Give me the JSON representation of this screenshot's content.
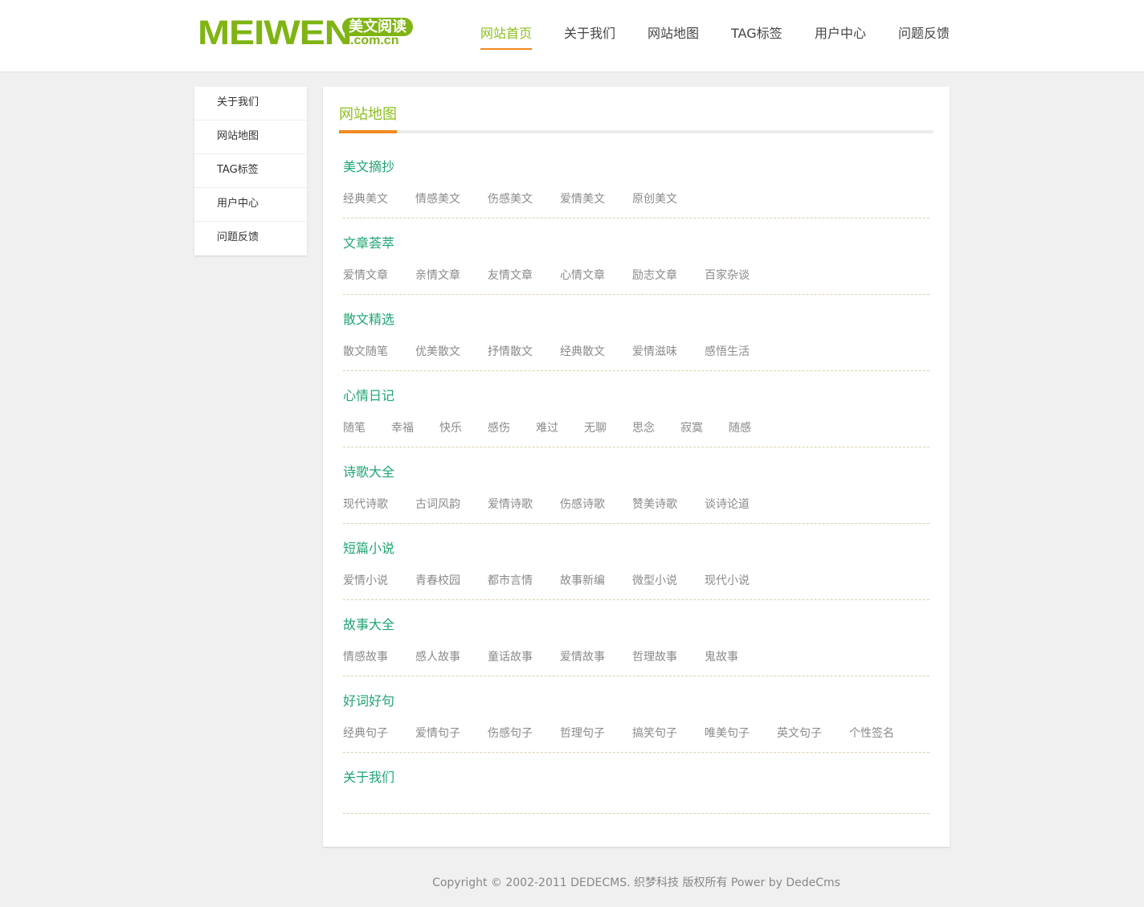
{
  "logo": {
    "main": "MEIWEN",
    "badge": "美文阅读",
    "domain": ".com.cn"
  },
  "nav": [
    {
      "label": "网站首页",
      "active": true
    },
    {
      "label": "关于我们"
    },
    {
      "label": "网站地图"
    },
    {
      "label": "TAG标签"
    },
    {
      "label": "用户中心"
    },
    {
      "label": "问题反馈"
    }
  ],
  "sidebar": [
    {
      "label": "关于我们"
    },
    {
      "label": "网站地图"
    },
    {
      "label": "TAG标签"
    },
    {
      "label": "用户中心"
    },
    {
      "label": "问题反馈"
    }
  ],
  "main": {
    "title": "网站地图",
    "sections": [
      {
        "title": "美文摘抄",
        "links": [
          "经典美文",
          "情感美文",
          "伤感美文",
          "爱情美文",
          "原创美文"
        ]
      },
      {
        "title": "文章荟萃",
        "links": [
          "爱情文章",
          "亲情文章",
          "友情文章",
          "心情文章",
          "励志文章",
          "百家杂谈"
        ]
      },
      {
        "title": "散文精选",
        "links": [
          "散文随笔",
          "优美散文",
          "抒情散文",
          "经典散文",
          "爱情滋味",
          "感悟生活"
        ]
      },
      {
        "title": "心情日记",
        "links": [
          "随笔",
          "幸福",
          "快乐",
          "感伤",
          "难过",
          "无聊",
          "思念",
          "寂寞",
          "随感"
        ]
      },
      {
        "title": "诗歌大全",
        "links": [
          "现代诗歌",
          "古词风韵",
          "爱情诗歌",
          "伤感诗歌",
          "赞美诗歌",
          "谈诗论道"
        ]
      },
      {
        "title": "短篇小说",
        "links": [
          "爱情小说",
          "青春校园",
          "都市言情",
          "故事新编",
          "微型小说",
          "现代小说"
        ]
      },
      {
        "title": "故事大全",
        "links": [
          "情感故事",
          "感人故事",
          "童话故事",
          "爱情故事",
          "哲理故事",
          "鬼故事"
        ]
      },
      {
        "title": "好词好句",
        "links": [
          "经典句子",
          "爱情句子",
          "伤感句子",
          "哲理句子",
          "搞笑句子",
          "唯美句子",
          "英文句子",
          "个性签名"
        ]
      },
      {
        "title": "关于我们",
        "links": []
      }
    ]
  },
  "footer": {
    "text": "Copyright © 2002-2011 DEDECMS. 织梦科技 版权所有 Power by DedeCms"
  },
  "colors": {
    "accent_green": "#8cbf1e",
    "section_green": "#1fa672",
    "accent_orange": "#f08a1e"
  }
}
